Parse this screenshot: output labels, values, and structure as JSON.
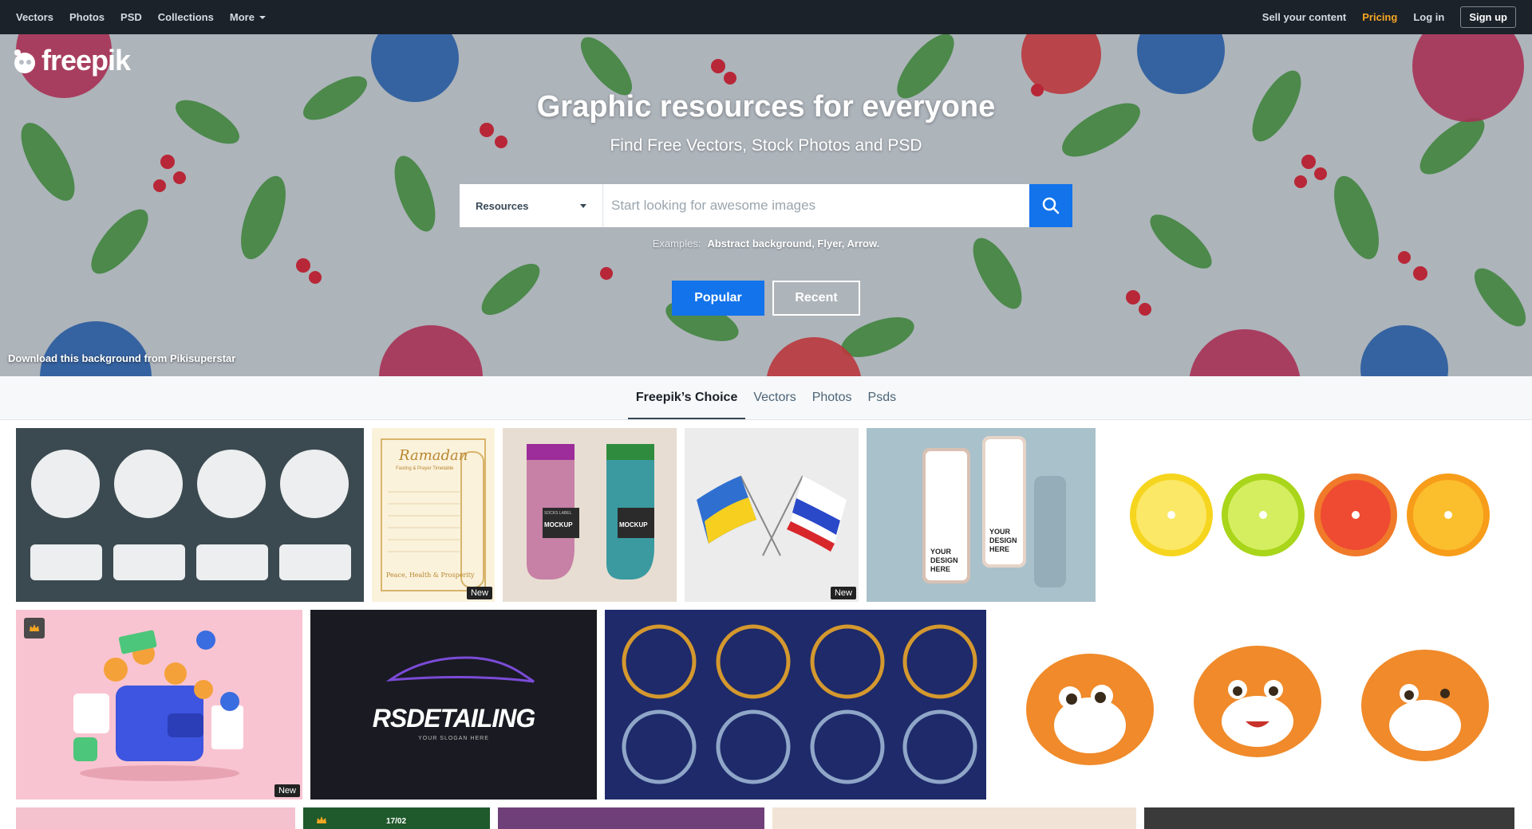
{
  "nav": {
    "left": [
      "Vectors",
      "Photos",
      "PSD",
      "Collections",
      "More"
    ],
    "sell": "Sell your content",
    "pricing": "Pricing",
    "login": "Log in",
    "signup": "Sign up"
  },
  "hero": {
    "logo": "freepik",
    "title": "Graphic resources for everyone",
    "subtitle": "Find Free Vectors, Stock Photos and PSD",
    "search": {
      "select": "Resources",
      "placeholder": "Start looking for awesome images"
    },
    "examples_label": "Examples:",
    "examples": "Abstract background, Flyer, Arrow.",
    "popular": "Popular",
    "recent": "Recent",
    "credit": "Download this background from Pikisuperstar"
  },
  "tabs": [
    "Freepik’s Choice",
    "Vectors",
    "Photos",
    "Psds"
  ],
  "tiles": {
    "ramadan_title": "Ramadan",
    "ramadan_sub": "Fasting & Prayer Timetable",
    "ramadan_footer": "Peace, Health & Prosperity",
    "sock_label": "MOCKUP",
    "sock_brand": "SOCKS LABEL",
    "phone_text": "YOUR DESIGN HERE",
    "logo_text": "RSDETAILING",
    "logo_slogan": "YOUR SLOGAN HERE",
    "new_badge": "New",
    "green_date": "17/02"
  },
  "colors": {
    "brand": "#1273eb",
    "nav": "#1c222a",
    "pricing": "#f5a623"
  }
}
